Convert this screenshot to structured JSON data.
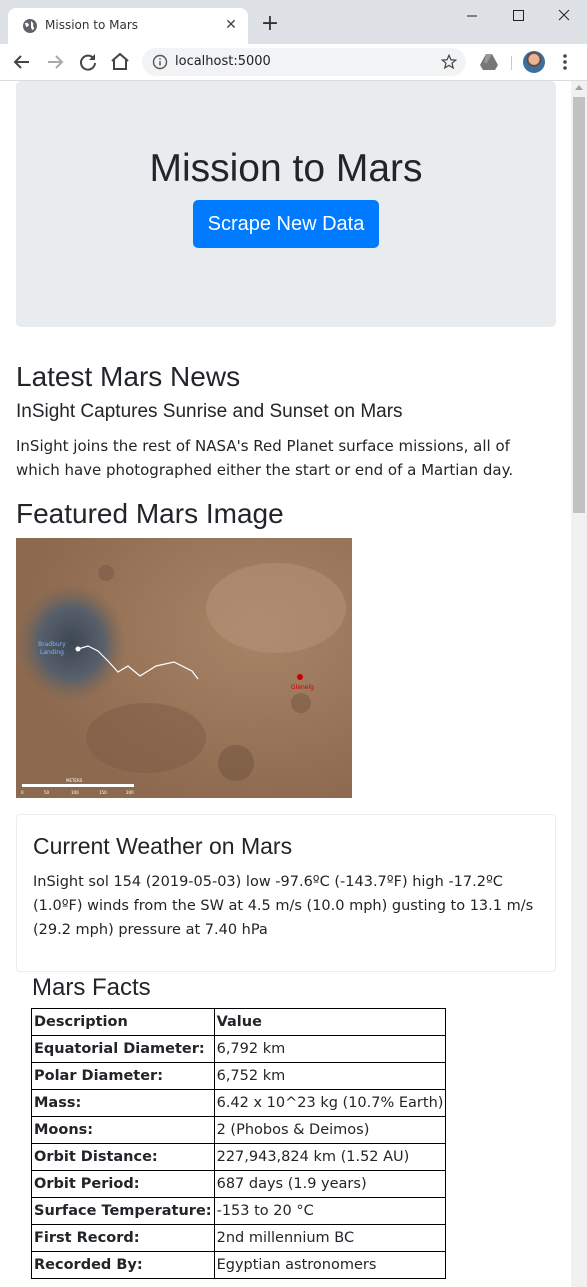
{
  "browser": {
    "tab_title": "Mission to Mars",
    "url": "localhost:5000"
  },
  "page": {
    "jumbotron": {
      "title": "Mission to Mars",
      "button_label": "Scrape New Data"
    },
    "news": {
      "section_title": "Latest Mars News",
      "headline": "InSight Captures Sunrise and Sunset on Mars",
      "teaser": "InSight joins the rest of NASA's Red Planet surface missions, all of which have photographed either the start or end of a Martian day."
    },
    "featured_image": {
      "section_title": "Featured Mars Image",
      "map_labels": {
        "landing": [
          "Bradbury",
          "Landing"
        ],
        "target": "Glenelg",
        "scale_title": "METERS",
        "scale_ticks": [
          "0",
          "50",
          "100",
          "150",
          "200"
        ]
      }
    },
    "weather": {
      "title": "Current Weather on Mars",
      "text": "InSight sol 154 (2019-05-03) low -97.6ºC (-143.7ºF) high -17.2ºC (1.0ºF) winds from the SW at 4.5 m/s (10.0 mph) gusting to 13.1 m/s (29.2 mph) pressure at 7.40 hPa"
    },
    "facts": {
      "title": "Mars Facts",
      "header": [
        "Description",
        "Value"
      ],
      "rows": [
        [
          "Equatorial Diameter:",
          "6,792 km"
        ],
        [
          "Polar Diameter:",
          "6,752 km"
        ],
        [
          "Mass:",
          "6.42 x 10^23 kg (10.7% Earth)"
        ],
        [
          "Moons:",
          "2 (Phobos & Deimos)"
        ],
        [
          "Orbit Distance:",
          "227,943,824 km (1.52 AU)"
        ],
        [
          "Orbit Period:",
          "687 days (1.9 years)"
        ],
        [
          "Surface Temperature:",
          "-153 to 20 °C"
        ],
        [
          "First Record:",
          "2nd millennium BC"
        ],
        [
          "Recorded By:",
          "Egyptian astronomers"
        ]
      ]
    }
  }
}
